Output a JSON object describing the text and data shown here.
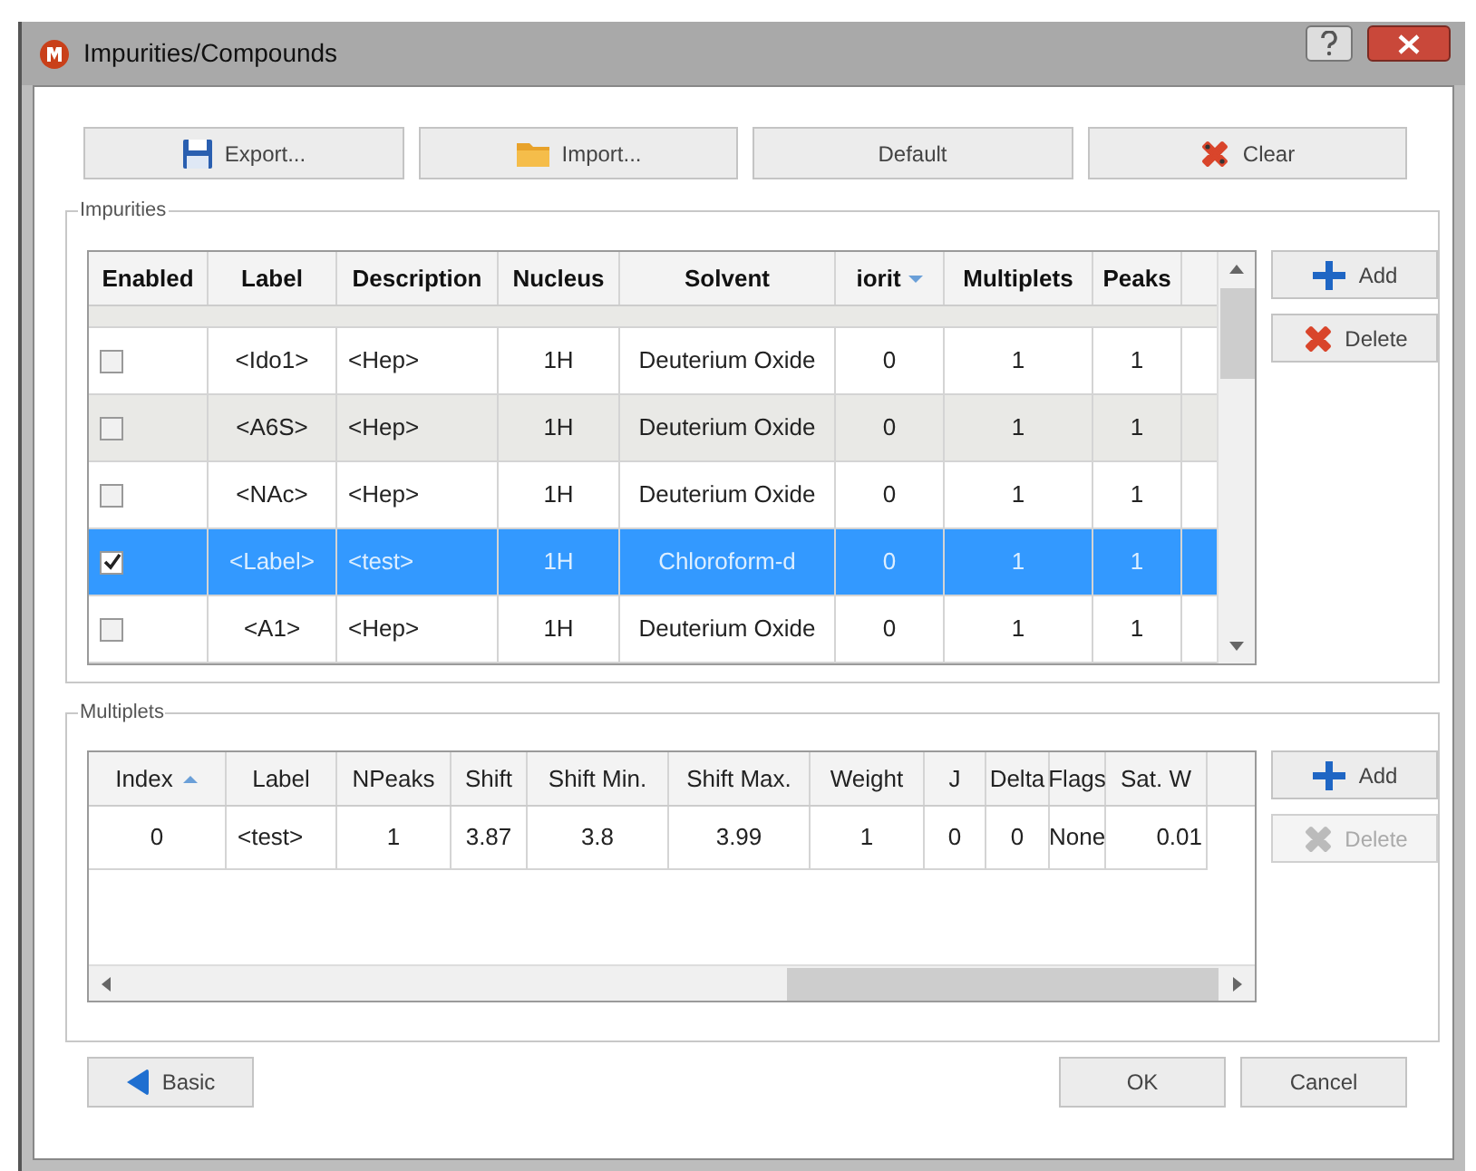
{
  "window": {
    "title": "Impurities/Compounds"
  },
  "toolbar": [
    {
      "label": "Export...",
      "kind": "export"
    },
    {
      "label": "Import...",
      "kind": "import"
    },
    {
      "label": "Default",
      "kind": "plain"
    },
    {
      "label": "Clear",
      "kind": "clear"
    }
  ],
  "impurities": {
    "title": "Impurities",
    "sort_ascending": false,
    "columns": [
      {
        "label": "Enabled",
        "sorted": false
      },
      {
        "label": "Label",
        "sorted": false
      },
      {
        "label": "Description",
        "sorted": false
      },
      {
        "label": "Nucleus",
        "sorted": false
      },
      {
        "label": "Solvent",
        "sorted": false
      },
      {
        "label": "iorit",
        "sorted": true
      },
      {
        "label": "Multiplets",
        "sorted": false
      },
      {
        "label": "Peaks",
        "sorted": false
      }
    ],
    "rows": [
      {
        "enabled": false,
        "selected": false,
        "label": "<Ido1>",
        "description": "<Hep>",
        "nucleus": "1H",
        "solvent": "Deuterium Oxide",
        "priority": "0",
        "multiplets": "1",
        "peaks": "1"
      },
      {
        "enabled": false,
        "selected": false,
        "label": "<A6S>",
        "description": "<Hep>",
        "nucleus": "1H",
        "solvent": "Deuterium Oxide",
        "priority": "0",
        "multiplets": "1",
        "peaks": "1"
      },
      {
        "enabled": false,
        "selected": false,
        "label": "<NAc>",
        "description": "<Hep>",
        "nucleus": "1H",
        "solvent": "Deuterium Oxide",
        "priority": "0",
        "multiplets": "1",
        "peaks": "1"
      },
      {
        "enabled": true,
        "selected": true,
        "label": "<Label>",
        "description": "<test>",
        "nucleus": "1H",
        "solvent": "Chloroform-d",
        "priority": "0",
        "multiplets": "1",
        "peaks": "1"
      },
      {
        "enabled": false,
        "selected": false,
        "label": "<A1>",
        "description": "<Hep>",
        "nucleus": "1H",
        "solvent": "Deuterium Oxide",
        "priority": "0",
        "multiplets": "1",
        "peaks": "1"
      }
    ],
    "buttons": [
      {
        "label": "Add",
        "kind": "add",
        "disabled": false
      },
      {
        "label": "Delete",
        "kind": "delete",
        "disabled": false
      }
    ]
  },
  "multiplets": {
    "title": "Multiplets",
    "sort_ascending": true,
    "columns": [
      {
        "label": "Index",
        "sorted": true
      },
      {
        "label": "Label",
        "sorted": false
      },
      {
        "label": "NPeaks",
        "sorted": false
      },
      {
        "label": "Shift",
        "sorted": false
      },
      {
        "label": "Shift Min.",
        "sorted": false
      },
      {
        "label": "Shift Max.",
        "sorted": false
      },
      {
        "label": "Weight",
        "sorted": false
      },
      {
        "label": "J",
        "sorted": false
      },
      {
        "label": "Delta",
        "sorted": false
      },
      {
        "label": "Flags",
        "sorted": false
      },
      {
        "label": "Sat. W",
        "sorted": false
      }
    ],
    "rows": [
      [
        "0",
        "<test>",
        "1",
        "3.87",
        "3.8",
        "3.99",
        "1",
        "0",
        "0",
        "None",
        "0.01"
      ]
    ],
    "buttons": [
      {
        "label": "Add",
        "kind": "add",
        "disabled": false
      },
      {
        "label": "Delete",
        "kind": "delete",
        "disabled": true
      }
    ]
  },
  "footer": {
    "left": [
      {
        "label": "Basic",
        "kind": "back"
      }
    ],
    "right": [
      {
        "label": "OK"
      },
      {
        "label": "Cancel"
      }
    ]
  }
}
